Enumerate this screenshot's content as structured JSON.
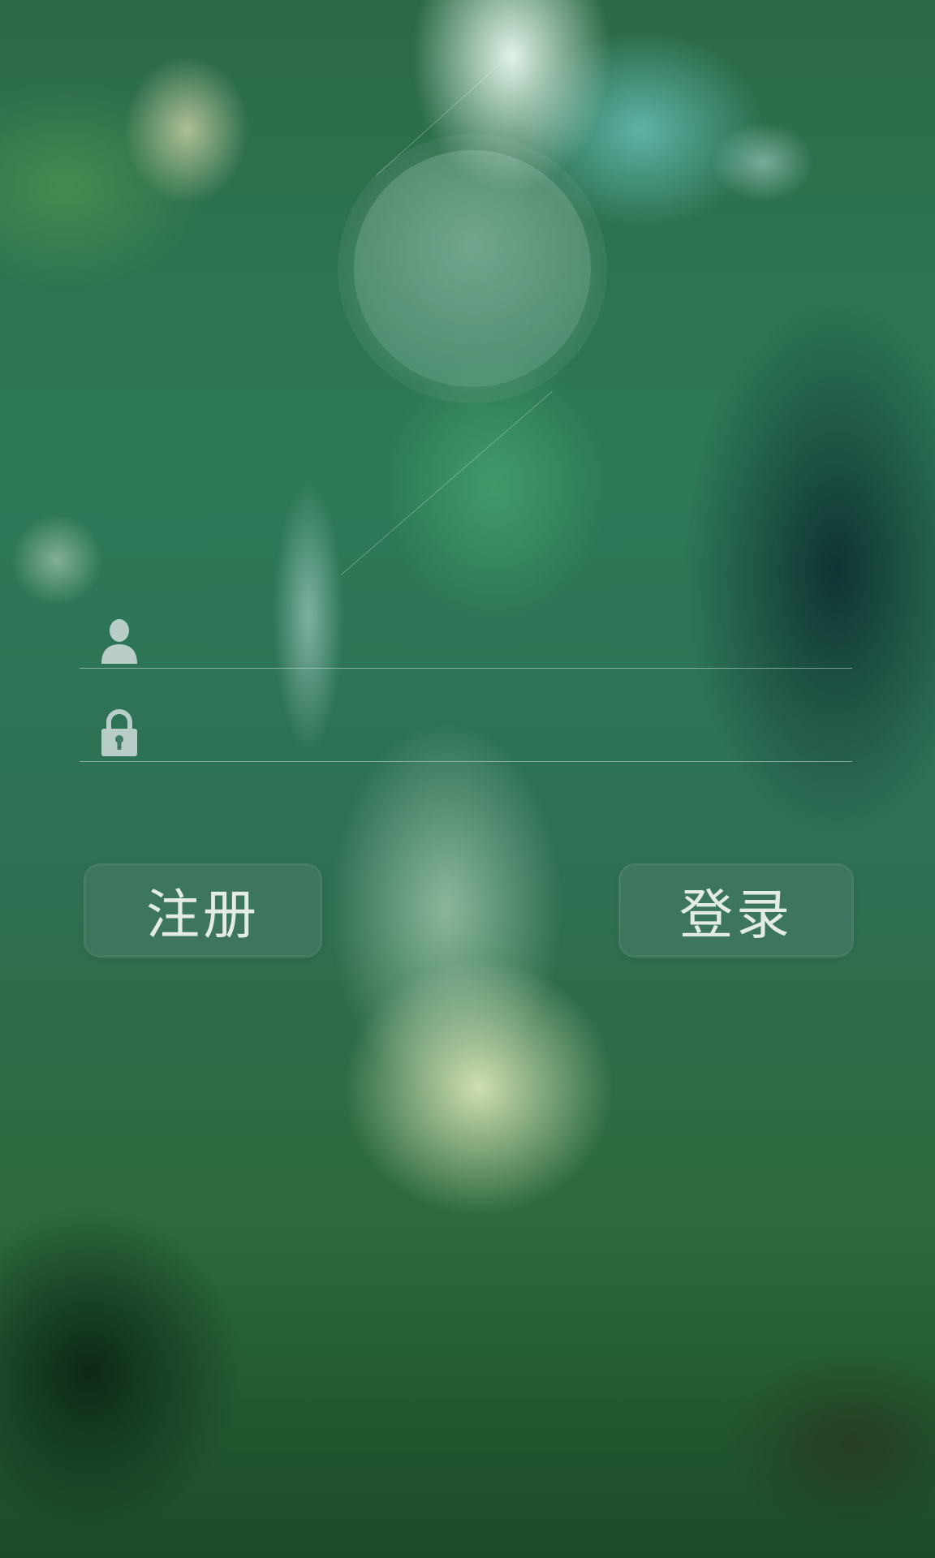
{
  "login_form": {
    "username": {
      "value": "",
      "placeholder": ""
    },
    "password": {
      "value": "",
      "placeholder": ""
    }
  },
  "buttons": {
    "register_label": "注册",
    "login_label": "登录"
  },
  "icons": {
    "username": "user-icon",
    "password": "lock-icon"
  },
  "colors": {
    "text": "#e3ebe5",
    "icon": "#b9cdc8",
    "divider": "#c8e1d7"
  }
}
